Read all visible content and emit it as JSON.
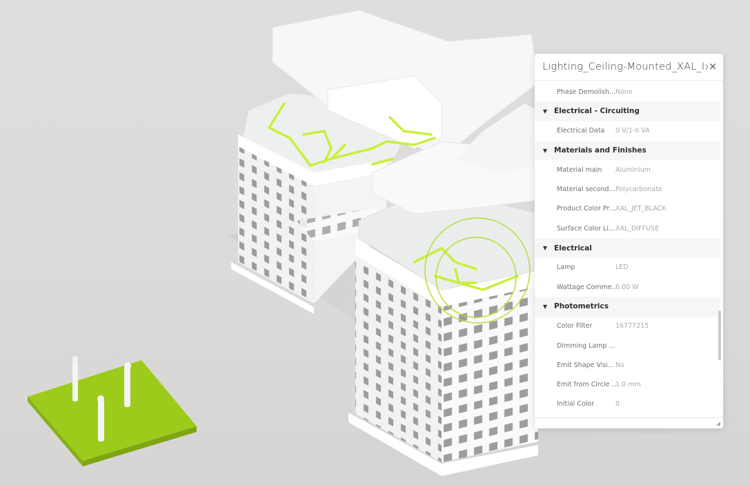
{
  "scene": {
    "background_color": "#dddcda",
    "accent_color": "#a9d82a",
    "highlight_color": "#c8f03c",
    "model_description": "Isometric white building model with green highlighted lighting circuits",
    "platform_description": "Green platform with three human figures"
  },
  "panel": {
    "title": "Lighting_Ceiling-Mounted_XAL_Ix",
    "close_icon": "×",
    "scroll_position": 0.82,
    "rows": [
      {
        "type": "property",
        "key": "Phase Demolish…",
        "value": "None"
      },
      {
        "type": "section",
        "title": "Electrical - Circuiting",
        "expanded": true
      },
      {
        "type": "property",
        "key": "Electrical Data",
        "value": "0 V/1-0 VA"
      },
      {
        "type": "section",
        "title": "Materials and Finishes",
        "expanded": true
      },
      {
        "type": "property",
        "key": "Material main",
        "value": "Aluminium"
      },
      {
        "type": "property",
        "key": "Material second…",
        "value": "Polycarbonate"
      },
      {
        "type": "property",
        "key": "Product Color Pr…",
        "value": "XAL_JET_BLACK"
      },
      {
        "type": "property",
        "key": "Surface Color Li…",
        "value": "XAL_DIFFUSE"
      },
      {
        "type": "section",
        "title": "Electrical",
        "expanded": true
      },
      {
        "type": "property",
        "key": "Lamp",
        "value": "LED"
      },
      {
        "type": "property",
        "key": "Wattage Comme…",
        "value": "6.00 W"
      },
      {
        "type": "section",
        "title": "Photometrics",
        "expanded": true
      },
      {
        "type": "property",
        "key": "Color Filter",
        "value": "16777215"
      },
      {
        "type": "property",
        "key": "Dimming Lamp …",
        "value": ""
      },
      {
        "type": "property",
        "key": "Emit Shape Visi…",
        "value": "No"
      },
      {
        "type": "property",
        "key": "Emit from Circle …",
        "value": "1.0 mm"
      },
      {
        "type": "property",
        "key": "Initial Color",
        "value": "0"
      }
    ]
  }
}
